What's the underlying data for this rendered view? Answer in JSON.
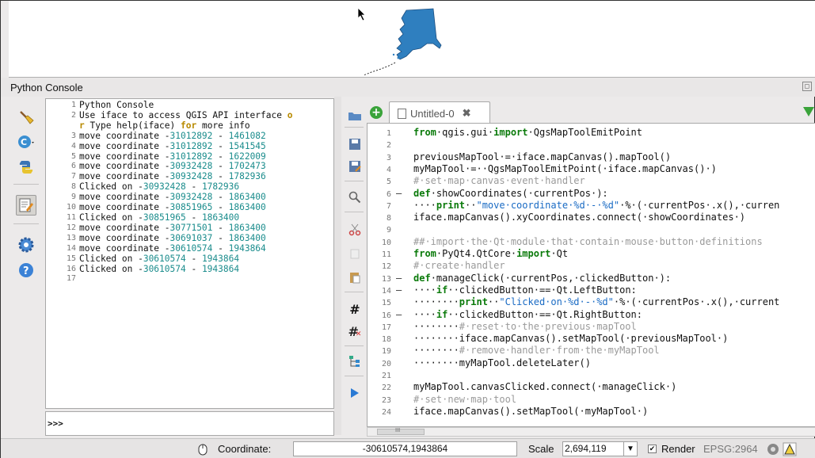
{
  "console": {
    "title": "Python Console",
    "prompt": ">>>"
  },
  "output_lines": [
    {
      "n": "1",
      "t": "Python Console"
    },
    {
      "n": "2",
      "t": "Use iface to access QGIS API interface "
    },
    {
      "n": "",
      "t": "r Type help(iface) "
    },
    {
      "n": "3",
      "t": "move coordinate -",
      "a": "31012892",
      "s": " - ",
      "b": "1461082"
    },
    {
      "n": "4",
      "t": "move coordinate -",
      "a": "31012892",
      "s": " - ",
      "b": "1541545"
    },
    {
      "n": "5",
      "t": "move coordinate -",
      "a": "31012892",
      "s": " - ",
      "b": "1622009"
    },
    {
      "n": "6",
      "t": "move coordinate -",
      "a": "30932428",
      "s": " - ",
      "b": "1702473"
    },
    {
      "n": "7",
      "t": "move coordinate -",
      "a": "30932428",
      "s": " - ",
      "b": "1782936"
    },
    {
      "n": "8",
      "t": "Clicked on -",
      "a": "30932428",
      "s": " - ",
      "b": "1782936"
    },
    {
      "n": "9",
      "t": "move coordinate -",
      "a": "30932428",
      "s": " - ",
      "b": "1863400"
    },
    {
      "n": "10",
      "t": "move coordinate -",
      "a": "30851965",
      "s": " - ",
      "b": "1863400"
    },
    {
      "n": "11",
      "t": "Clicked on -",
      "a": "30851965",
      "s": " - ",
      "b": "1863400"
    },
    {
      "n": "12",
      "t": "move coordinate -",
      "a": "30771501",
      "s": " - ",
      "b": "1863400"
    },
    {
      "n": "13",
      "t": "move coordinate -",
      "a": "30691037",
      "s": " - ",
      "b": "1863400"
    },
    {
      "n": "14",
      "t": "move coordinate -",
      "a": "30610574",
      "s": " - ",
      "b": "1943864"
    },
    {
      "n": "15",
      "t": "Clicked on -",
      "a": "30610574",
      "s": " - ",
      "b": "1943864"
    },
    {
      "n": "16",
      "t": "Clicked on -",
      "a": "30610574",
      "s": " - ",
      "b": "1943864"
    },
    {
      "n": "17",
      "t": ""
    }
  ],
  "output_kw": {
    "o": "o",
    "r": "r",
    "for": "for",
    "tail": " more info"
  },
  "editor": {
    "tab": "Untitled-0",
    "lines": [
      {
        "n": "1",
        "f": "",
        "h": [
          [
            "k",
            "from"
          ],
          [
            "",
            "·qgis.gui·"
          ],
          [
            "k",
            "import"
          ],
          [
            "",
            "·QgsMapToolEmitPoint"
          ]
        ]
      },
      {
        "n": "2",
        "f": "",
        "h": []
      },
      {
        "n": "3",
        "f": "",
        "h": [
          [
            "",
            "previousMapTool·=·iface.mapCanvas().mapTool()"
          ]
        ]
      },
      {
        "n": "4",
        "f": "",
        "h": [
          [
            "",
            "myMapTool·=··QgsMapToolEmitPoint(·iface.mapCanvas()·)"
          ]
        ]
      },
      {
        "n": "5",
        "f": "",
        "h": [
          [
            "c",
            "#·set·map·canvas·event·handler"
          ]
        ]
      },
      {
        "n": "6",
        "f": "–",
        "h": [
          [
            "k",
            "def"
          ],
          [
            "",
            "·showCoordinates(·currentPos·):"
          ]
        ]
      },
      {
        "n": "7",
        "f": "",
        "h": [
          [
            "",
            "····"
          ],
          [
            "k",
            "print"
          ],
          [
            "",
            "··"
          ],
          [
            "s",
            "\"move·coordinate·%d·-·%d\""
          ],
          [
            "",
            "·%·(·currentPos·.x(),·curren"
          ]
        ]
      },
      {
        "n": "8",
        "f": "",
        "h": [
          [
            "",
            "iface.mapCanvas().xyCoordinates.connect(·showCoordinates·)"
          ]
        ]
      },
      {
        "n": "9",
        "f": "",
        "h": []
      },
      {
        "n": "10",
        "f": "",
        "h": [
          [
            "c",
            "##·import·the·Qt·module·that·contain·mouse·button·definitions"
          ]
        ]
      },
      {
        "n": "11",
        "f": "",
        "h": [
          [
            "k",
            "from"
          ],
          [
            "",
            "·PyQt4.QtCore·"
          ],
          [
            "k",
            "import"
          ],
          [
            "",
            "·Qt"
          ]
        ]
      },
      {
        "n": "12",
        "f": "",
        "h": [
          [
            "c",
            "#·create·handler"
          ]
        ]
      },
      {
        "n": "13",
        "f": "–",
        "h": [
          [
            "k",
            "def"
          ],
          [
            "",
            "·manageClick(·currentPos,·clickedButton·):"
          ]
        ]
      },
      {
        "n": "14",
        "f": "–",
        "h": [
          [
            "",
            "····"
          ],
          [
            "k",
            "if"
          ],
          [
            "",
            "··clickedButton·==·Qt.LeftButton:"
          ]
        ]
      },
      {
        "n": "15",
        "f": "",
        "h": [
          [
            "",
            "········"
          ],
          [
            "k",
            "print"
          ],
          [
            "",
            "··"
          ],
          [
            "s",
            "\"Clicked·on·%d·-·%d\""
          ],
          [
            "",
            "·%·(·currentPos·.x(),·current"
          ]
        ]
      },
      {
        "n": "16",
        "f": "–",
        "h": [
          [
            "",
            "····"
          ],
          [
            "k",
            "if"
          ],
          [
            "",
            "··clickedButton·==·Qt.RightButton:"
          ]
        ]
      },
      {
        "n": "17",
        "f": "",
        "h": [
          [
            "",
            "········"
          ],
          [
            "c",
            "#·reset·to·the·previous·mapTool"
          ]
        ]
      },
      {
        "n": "18",
        "f": "",
        "h": [
          [
            "",
            "········iface.mapCanvas().setMapTool(·previousMapTool·)"
          ]
        ]
      },
      {
        "n": "19",
        "f": "",
        "h": [
          [
            "",
            "········"
          ],
          [
            "c",
            "#·remove·handler·from·the·myMapTool"
          ]
        ]
      },
      {
        "n": "20",
        "f": "",
        "h": [
          [
            "",
            "········myMapTool.deleteLater()"
          ]
        ]
      },
      {
        "n": "21",
        "f": "",
        "h": []
      },
      {
        "n": "22",
        "f": "",
        "h": [
          [
            "",
            "myMapTool.canvasClicked.connect(·manageClick·)"
          ]
        ]
      },
      {
        "n": "23",
        "f": "",
        "h": [
          [
            "c",
            "#·set·new·map·tool"
          ]
        ]
      },
      {
        "n": "24",
        "f": "",
        "h": [
          [
            "",
            "iface.mapCanvas().setMapTool(·myMapTool·)"
          ]
        ]
      }
    ]
  },
  "status": {
    "coord_label": "Coordinate:",
    "coord_value": "-30610574,1943864",
    "scale_label": "Scale",
    "scale_value": "2,694,119",
    "render_label": "Render",
    "epsg": "EPSG:2964",
    "scroll_label": "III"
  },
  "colors": {
    "keyword": "#0a7a0a",
    "number": "#1a8c8c",
    "string": "#1a6bc4",
    "comment": "#9a9a9a"
  }
}
